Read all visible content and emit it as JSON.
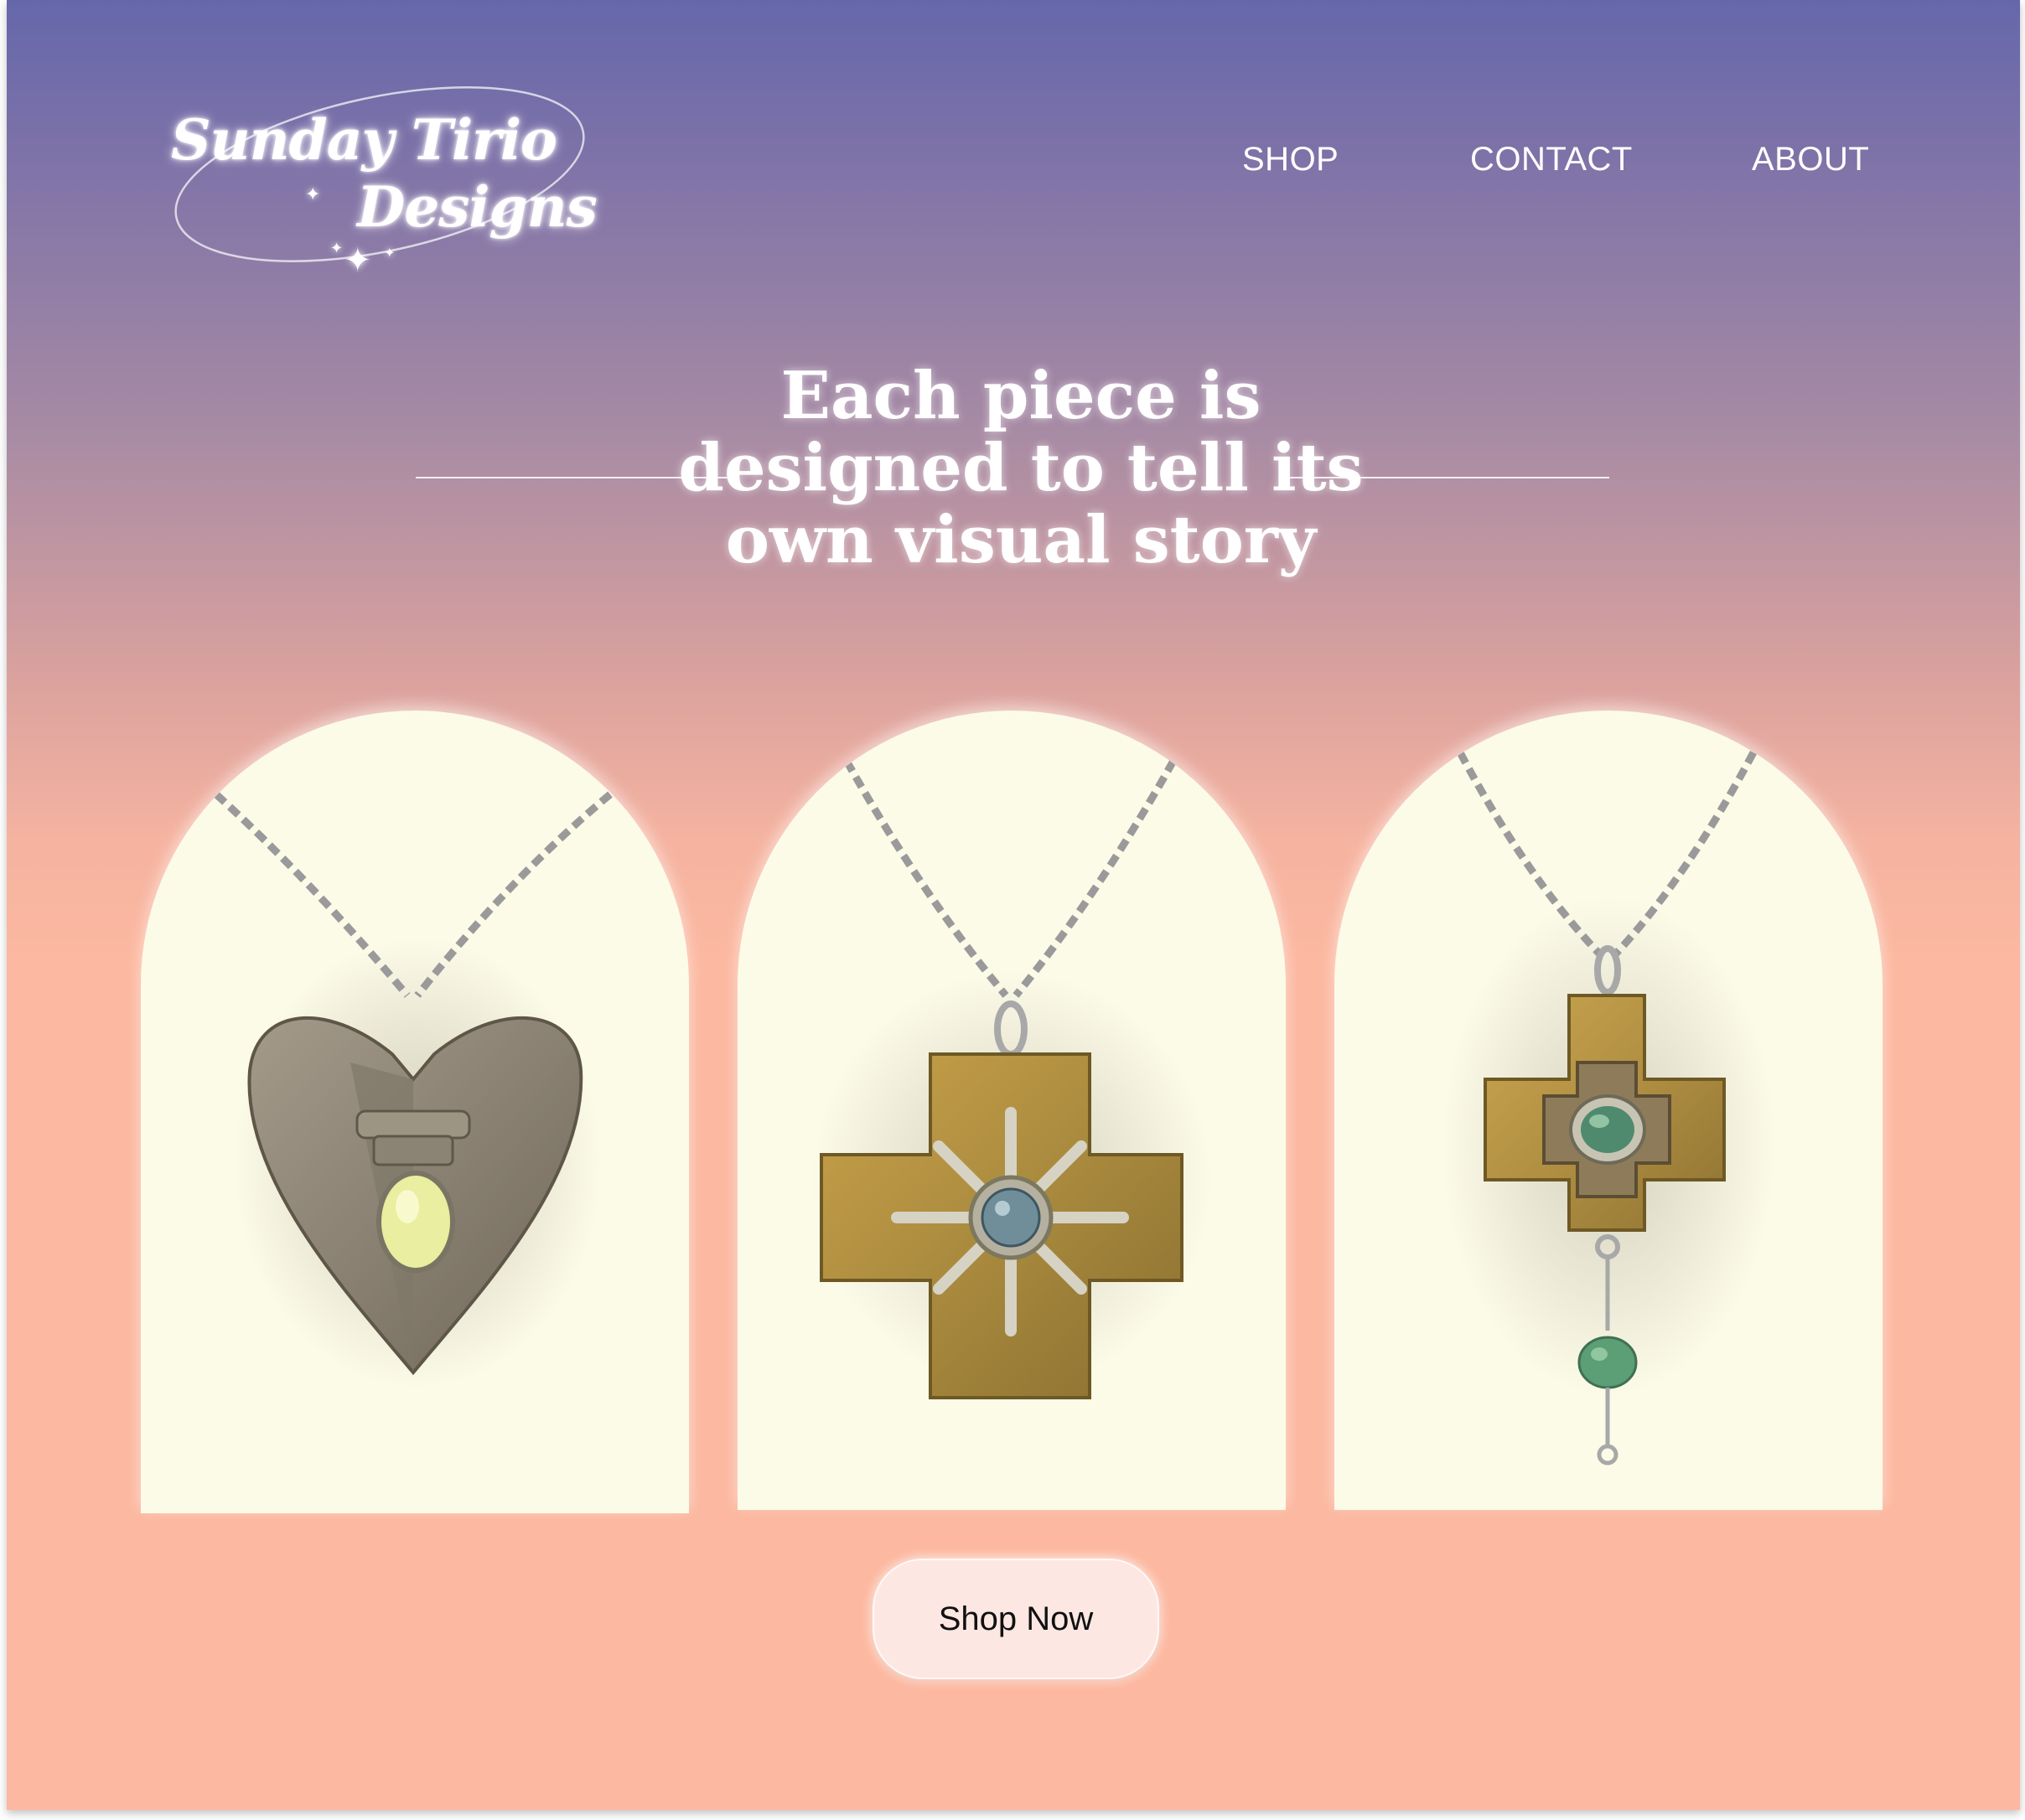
{
  "brand": {
    "line1": "Sunday Tirio",
    "line2": "Designs"
  },
  "nav": {
    "items": [
      {
        "label": "SHOP"
      },
      {
        "label": "CONTACT"
      },
      {
        "label": "ABOUT"
      }
    ]
  },
  "hero": {
    "title_lines": [
      "Each piece is",
      "designed to tell its",
      "own visual story"
    ]
  },
  "products": [
    {
      "icon": "heart-pendant-necklace-icon",
      "stone_color": "#e9eea0"
    },
    {
      "icon": "cross-pendant-necklace-icon",
      "stone_color": "#6f8e9a"
    },
    {
      "icon": "cross-drop-pendant-necklace-icon",
      "stone_color": "#4f8a6e"
    }
  ],
  "cta": {
    "label": "Shop Now"
  },
  "colors": {
    "gradient_top": "#6567ab",
    "gradient_bottom": "#fcb8a0",
    "arch_background": "#fcfbe8",
    "button_background": "#fde7e2"
  }
}
